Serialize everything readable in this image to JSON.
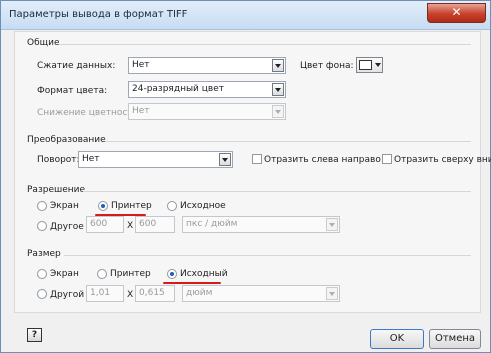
{
  "window": {
    "title": "Параметры вывода в формат TIFF",
    "close_glyph": "✕",
    "accent_color": "#d61b1b"
  },
  "general": {
    "section_title": "Общие",
    "compression_label": "Сжатие данных:",
    "compression_value": "Нет",
    "color_format_label": "Формат цвета:",
    "color_format_value": "24-разрядный цвет",
    "color_reduction_label": "Снижение цветности:",
    "color_reduction_value": "Нет",
    "background_label": "Цвет фона:",
    "background_color": "#ffffff"
  },
  "transform": {
    "section_title": "Преобразование",
    "rotation_label": "Поворот:",
    "rotation_value": "Нет",
    "flip_h_label": "Отразить слева направо",
    "flip_h_checked": false,
    "flip_v_label": "Отразить сверху вниз",
    "flip_v_checked": false
  },
  "resolution": {
    "section_title": "Разрешение",
    "screen_label": "Экран",
    "printer_label": "Принтер",
    "source_label": "Исходное",
    "other_label": "Другое",
    "selected": "printer",
    "x_value": "600",
    "times_sign": "X",
    "y_value": "600",
    "units_value": "пкс / дюйм"
  },
  "size": {
    "section_title": "Размер",
    "screen_label": "Экран",
    "printer_label": "Принтер",
    "source_label": "Исходный",
    "other_label": "Другой",
    "selected": "source",
    "width_value": "1,01",
    "times_sign": "X",
    "height_value": "0,615",
    "units_value": "дюйм"
  },
  "footer": {
    "help_glyph": "?",
    "ok_label": "OK",
    "cancel_label": "Отмена"
  }
}
